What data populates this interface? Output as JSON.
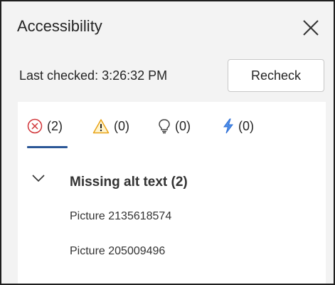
{
  "pane": {
    "title": "Accessibility",
    "close_icon": "close-icon"
  },
  "status": {
    "last_checked": "Last checked: 3:26:32 PM",
    "recheck_label": "Recheck"
  },
  "tabs": [
    {
      "icon": "error-circle-icon",
      "count": "(2)",
      "selected": true,
      "color": "#d13438"
    },
    {
      "icon": "warning-icon",
      "count": "(0)",
      "selected": false,
      "color": "#e8a317"
    },
    {
      "icon": "lightbulb-icon",
      "count": "(0)",
      "selected": false,
      "color": "#424242"
    },
    {
      "icon": "lightning-icon",
      "count": "(0)",
      "selected": false,
      "color": "#2b6cd4"
    }
  ],
  "category": {
    "expand_icon": "chevron-down-icon",
    "title": "Missing alt text (2)",
    "items": [
      "Picture 2135618574",
      "Picture 205009496"
    ]
  },
  "colors": {
    "accent": "#2b5797",
    "pane_background": "#f3f3f3"
  }
}
